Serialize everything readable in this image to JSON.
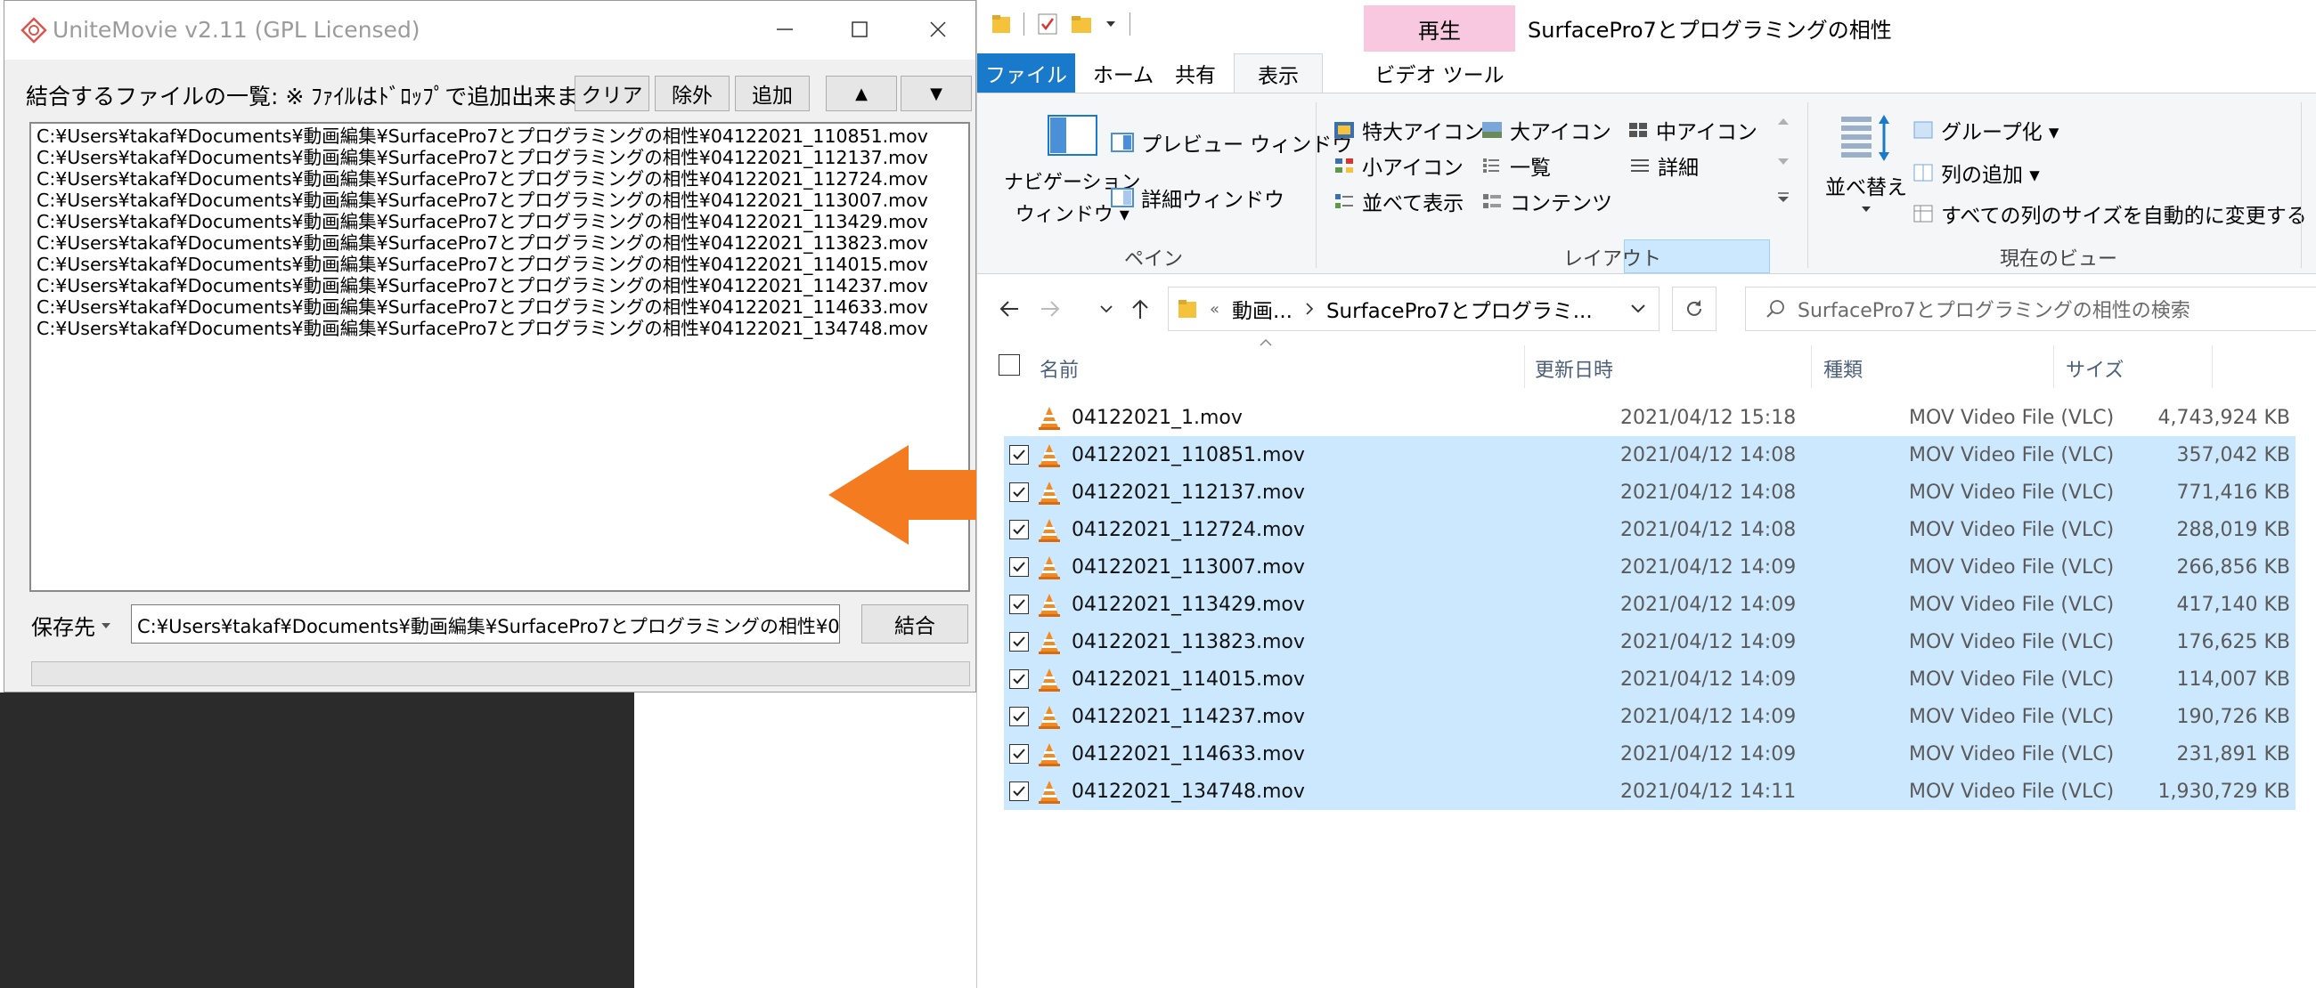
{
  "unitemovie": {
    "title": "UniteMovie v2.11 (GPL Licensed)",
    "list_label": "結合するファイルの一覧: ※ ﾌｧｲﾙはﾄﾞﾛｯﾌﾟで追加出来ます。",
    "buttons": {
      "clear": "クリア",
      "remove": "除外",
      "add": "追加",
      "up": "▲",
      "down": "▼"
    },
    "files": [
      "C:¥Users¥takaf¥Documents¥動画編集¥SurfacePro7とプログラミングの相性¥04122021_110851.mov",
      "C:¥Users¥takaf¥Documents¥動画編集¥SurfacePro7とプログラミングの相性¥04122021_112137.mov",
      "C:¥Users¥takaf¥Documents¥動画編集¥SurfacePro7とプログラミングの相性¥04122021_112724.mov",
      "C:¥Users¥takaf¥Documents¥動画編集¥SurfacePro7とプログラミングの相性¥04122021_113007.mov",
      "C:¥Users¥takaf¥Documents¥動画編集¥SurfacePro7とプログラミングの相性¥04122021_113429.mov",
      "C:¥Users¥takaf¥Documents¥動画編集¥SurfacePro7とプログラミングの相性¥04122021_113823.mov",
      "C:¥Users¥takaf¥Documents¥動画編集¥SurfacePro7とプログラミングの相性¥04122021_114015.mov",
      "C:¥Users¥takaf¥Documents¥動画編集¥SurfacePro7とプログラミングの相性¥04122021_114237.mov",
      "C:¥Users¥takaf¥Documents¥動画編集¥SurfacePro7とプログラミングの相性¥04122021_114633.mov",
      "C:¥Users¥takaf¥Documents¥動画編集¥SurfacePro7とプログラミングの相性¥04122021_134748.mov"
    ],
    "save_label": "保存先",
    "save_path": "C:¥Users¥takaf¥Documents¥動画編集¥SurfacePro7とプログラミングの相性¥0",
    "join_label": "結合"
  },
  "explorer": {
    "context_tab": "再生",
    "title": "SurfacePro7とプログラミングの相性",
    "tabs": {
      "file": "ファイル",
      "home": "ホーム",
      "share": "共有",
      "view": "表示",
      "video": "ビデオ ツール"
    },
    "ribbon": {
      "nav_pane": "ナビゲーション\nウィンドウ",
      "nav_pane_line1": "ナビゲーション",
      "nav_pane_line2": "ウィンドウ ▾",
      "preview_pane": "プレビュー ウィンドウ",
      "details_pane": "詳細ウィンドウ",
      "pane_group": "ペイン",
      "xl_icons": "特大アイコン",
      "l_icons": "大アイコン",
      "m_icons": "中アイコン",
      "s_icons": "小アイコン",
      "list": "一覧",
      "details": "詳細",
      "tiles": "並べて表示",
      "content": "コンテンツ",
      "layout_group": "レイアウト",
      "sort_by": "並べ替え",
      "group_by": "グループ化 ▾",
      "add_columns": "列の追加 ▾",
      "size_columns": "すべての列のサイズを自動的に変更する",
      "current_view_group": "現在のビュー"
    },
    "address": {
      "crumb1": "動画...",
      "crumb2": "SurfacePro7とプログラミ...",
      "back_arrow": "«"
    },
    "search_placeholder": "SurfacePro7とプログラミングの相性の検索",
    "columns": {
      "name": "名前",
      "date": "更新日時",
      "type": "種類",
      "size": "サイズ"
    },
    "files": [
      {
        "name": "04122021_1.mov",
        "date": "2021/04/12 15:18",
        "type": "MOV Video File (VLC)",
        "size": "4,743,924 KB",
        "selected": false
      },
      {
        "name": "04122021_110851.mov",
        "date": "2021/04/12 14:08",
        "type": "MOV Video File (VLC)",
        "size": "357,042 KB",
        "selected": true
      },
      {
        "name": "04122021_112137.mov",
        "date": "2021/04/12 14:08",
        "type": "MOV Video File (VLC)",
        "size": "771,416 KB",
        "selected": true
      },
      {
        "name": "04122021_112724.mov",
        "date": "2021/04/12 14:08",
        "type": "MOV Video File (VLC)",
        "size": "288,019 KB",
        "selected": true
      },
      {
        "name": "04122021_113007.mov",
        "date": "2021/04/12 14:09",
        "type": "MOV Video File (VLC)",
        "size": "266,856 KB",
        "selected": true
      },
      {
        "name": "04122021_113429.mov",
        "date": "2021/04/12 14:09",
        "type": "MOV Video File (VLC)",
        "size": "417,140 KB",
        "selected": true
      },
      {
        "name": "04122021_113823.mov",
        "date": "2021/04/12 14:09",
        "type": "MOV Video File (VLC)",
        "size": "176,625 KB",
        "selected": true
      },
      {
        "name": "04122021_114015.mov",
        "date": "2021/04/12 14:09",
        "type": "MOV Video File (VLC)",
        "size": "114,007 KB",
        "selected": true
      },
      {
        "name": "04122021_114237.mov",
        "date": "2021/04/12 14:09",
        "type": "MOV Video File (VLC)",
        "size": "190,726 KB",
        "selected": true
      },
      {
        "name": "04122021_114633.mov",
        "date": "2021/04/12 14:09",
        "type": "MOV Video File (VLC)",
        "size": "231,891 KB",
        "selected": true
      },
      {
        "name": "04122021_134748.mov",
        "date": "2021/04/12 14:11",
        "type": "MOV Video File (VLC)",
        "size": "1,930,729 KB",
        "selected": true
      }
    ]
  },
  "colors": {
    "selection": "#cce8ff",
    "file_tab": "#1979ca",
    "context_tab": "#f7c8df",
    "arrow": "#f47b20",
    "vlc_cone": "#f08a24"
  }
}
